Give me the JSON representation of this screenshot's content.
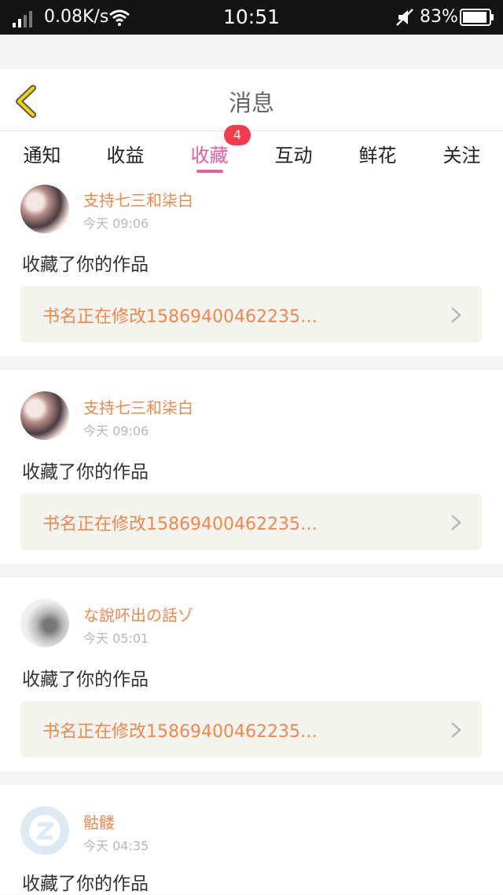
{
  "status_bar": {
    "network_speed": "0.08K/s",
    "time": "10:51",
    "battery": "83%"
  },
  "header": {
    "title": "消息"
  },
  "tabs": [
    {
      "label": "通知",
      "active": false
    },
    {
      "label": "收益",
      "active": false
    },
    {
      "label": "收藏",
      "active": true,
      "badge": "4"
    },
    {
      "label": "互动",
      "active": false
    },
    {
      "label": "鲜花",
      "active": false
    },
    {
      "label": "关注",
      "active": false
    }
  ],
  "accent_color": "#e75d9d",
  "messages": [
    {
      "username": "支持七三和柒白",
      "time": "今天 09:06",
      "action": "收藏了你的作品",
      "book": "书名正在修改15869400462235…"
    },
    {
      "username": "支持七三和柒白",
      "time": "今天 09:06",
      "action": "收藏了你的作品",
      "book": "书名正在修改15869400462235…"
    },
    {
      "username": "な說吥出の話ゾ",
      "time": "今天 05:01",
      "action": "收藏了你的作品",
      "book": "书名正在修改15869400462235…"
    },
    {
      "username": "骷髅",
      "time": "今天 04:35",
      "action": "收藏了你的作品"
    }
  ]
}
